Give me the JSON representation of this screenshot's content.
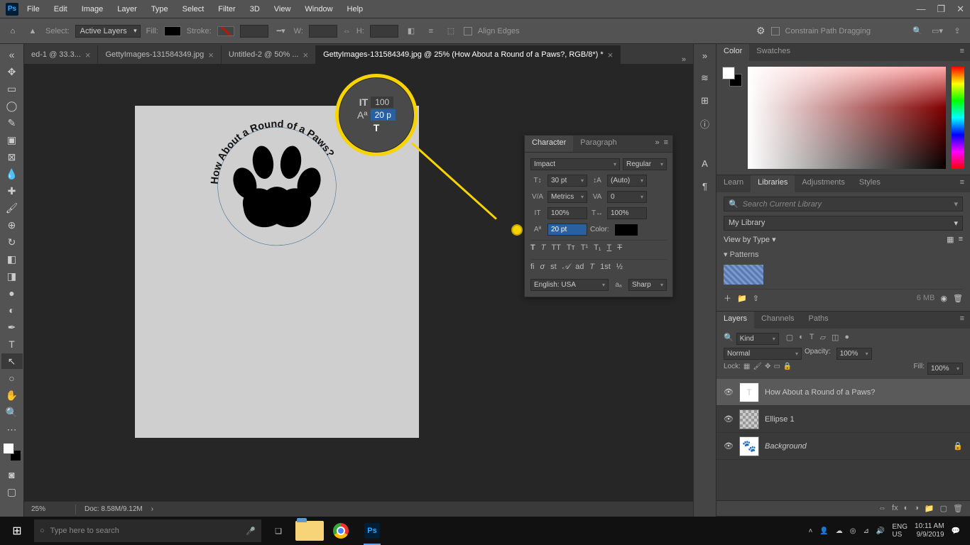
{
  "menubar": {
    "items": [
      "File",
      "Edit",
      "Image",
      "Layer",
      "Type",
      "Select",
      "Filter",
      "3D",
      "View",
      "Window",
      "Help"
    ]
  },
  "optionsbar": {
    "select_label": "Select:",
    "select_value": "Active Layers",
    "fill_label": "Fill:",
    "stroke_label": "Stroke:",
    "w_label": "W:",
    "h_label": "H:",
    "align_edges": "Align Edges",
    "constrain": "Constrain Path Dragging"
  },
  "tabs": [
    {
      "label": "ed-1 @ 33.3..."
    },
    {
      "label": "GettyImages-131584349.jpg"
    },
    {
      "label": "Untitled-2 @ 50% ..."
    },
    {
      "label": "GettyImages-131584349.jpg @ 25% (How About a Round of a Paws?, RGB/8*) *",
      "active": true
    }
  ],
  "canvas": {
    "arc_text": "How About a Round of a Paws?"
  },
  "status": {
    "zoom": "25%",
    "doc": "Doc: 8.58M/9.12M"
  },
  "char_panel": {
    "tabs": [
      "Character",
      "Paragraph"
    ],
    "font": "Impact",
    "style": "Regular",
    "size": "30 pt",
    "leading": "(Auto)",
    "kerning": "Metrics",
    "tracking": "0",
    "vscale": "100%",
    "hscale": "100%",
    "baseline": "20 pt",
    "color_label": "Color:",
    "lang": "English: USA",
    "aa": "Sharp"
  },
  "magnifier": {
    "row1": "100",
    "row2": "20 p"
  },
  "color_panel": {
    "tabs": [
      "Color",
      "Swatches"
    ]
  },
  "libraries": {
    "tabs": [
      "Learn",
      "Libraries",
      "Adjustments",
      "Styles"
    ],
    "search_placeholder": "Search Current Library",
    "library": "My Library",
    "view": "View by Type",
    "patterns": "Patterns",
    "size": "6 MB"
  },
  "layers": {
    "tabs": [
      "Layers",
      "Channels",
      "Paths"
    ],
    "filter": "Kind",
    "blend": "Normal",
    "opacity_label": "Opacity:",
    "opacity": "100%",
    "lock_label": "Lock:",
    "fill_label": "Fill:",
    "fill": "100%",
    "items": [
      {
        "name": "How About a Round of a Paws?",
        "type": "text",
        "active": true
      },
      {
        "name": "Ellipse 1",
        "type": "shape"
      },
      {
        "name": "Background",
        "type": "bg",
        "locked": true
      }
    ]
  },
  "taskbar": {
    "search_placeholder": "Type here to search",
    "lang": "ENG",
    "region": "US",
    "time": "10:11 AM",
    "date": "9/9/2019"
  }
}
